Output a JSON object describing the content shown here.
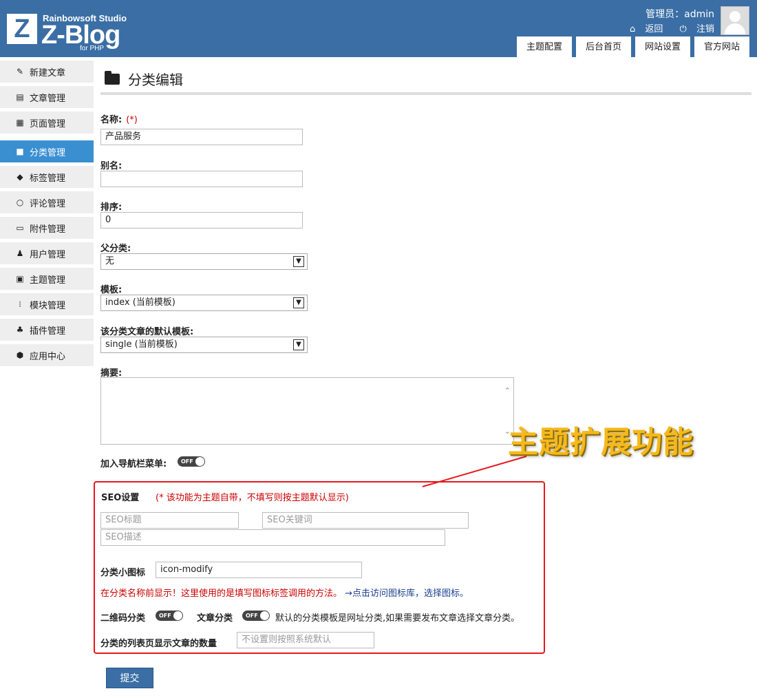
{
  "header": {
    "logo_studio": "Rainbowsoft Studio",
    "logo_blog": "Z-Blog",
    "logo_php": "for PHP",
    "admin_label": "管理员：admin",
    "back_label": "返回",
    "logout_label": "注销",
    "tabs": [
      "主题配置",
      "后台首页",
      "网站设置",
      "官方网站"
    ]
  },
  "sidebar": {
    "items": [
      {
        "label": "新建文章",
        "icon": "edit-icon"
      },
      {
        "label": "文章管理",
        "icon": "document-icon"
      },
      {
        "label": "页面管理",
        "icon": "page-icon"
      },
      {
        "label": "分类管理",
        "icon": "folder-icon"
      },
      {
        "label": "标签管理",
        "icon": "tag-icon"
      },
      {
        "label": "评论管理",
        "icon": "comment-icon"
      },
      {
        "label": "附件管理",
        "icon": "inbox-icon"
      },
      {
        "label": "用户管理",
        "icon": "user-icon"
      },
      {
        "label": "主题管理",
        "icon": "layout-icon"
      },
      {
        "label": "模块管理",
        "icon": "module-icon"
      },
      {
        "label": "插件管理",
        "icon": "plug-icon"
      },
      {
        "label": "应用中心",
        "icon": "cube-icon"
      }
    ],
    "active_index": 3
  },
  "main": {
    "title": "分类编辑",
    "name_label": "名称:",
    "name_required": "(*)",
    "name_value": "产品服务",
    "alias_label": "别名:",
    "alias_value": "",
    "order_label": "排序:",
    "order_value": "0",
    "parent_label": "父分类:",
    "parent_value": "无",
    "template_label": "模板:",
    "template_value": "index (当前模板)",
    "article_template_label": "该分类文章的默认模板:",
    "article_template_value": "single (当前模板)",
    "summary_label": "摘要:",
    "nav_label": "加入导航栏菜单:",
    "nav_toggle": "OFF"
  },
  "annotation": {
    "text": "主题扩展功能",
    "color": "#f6b81a"
  },
  "seo": {
    "title": "SEO设置",
    "note": "(* 该功能为主题自带，不填写则按主题默认显示)",
    "seo_title_placeholder": "SEO标题",
    "seo_keywords_placeholder": "SEO关键词",
    "seo_desc_placeholder": "SEO描述",
    "icon_label": "分类小图标",
    "icon_value": "icon-modify",
    "icon_note": "在分类名称前显示！这里使用的是填写图标标签调用的方法。",
    "icon_link": "→点击访问图标库，选择图标。",
    "qrcode_label": "二维码分类",
    "qrcode_toggle": "OFF",
    "article_cat_label": "文章分类",
    "article_cat_toggle": "OFF",
    "article_cat_note": "默认的分类模板是网址分类,如果需要发布文章选择文章分类。",
    "count_label": "分类的列表页显示文章的数量",
    "count_placeholder": "不设置则按照系统默认"
  },
  "submit_label": "提交",
  "colors": {
    "header_bg": "#3a6ea5",
    "active_item": "#3a8fd1",
    "highlight_border": "#e8161b",
    "required_red": "#cc0000"
  }
}
